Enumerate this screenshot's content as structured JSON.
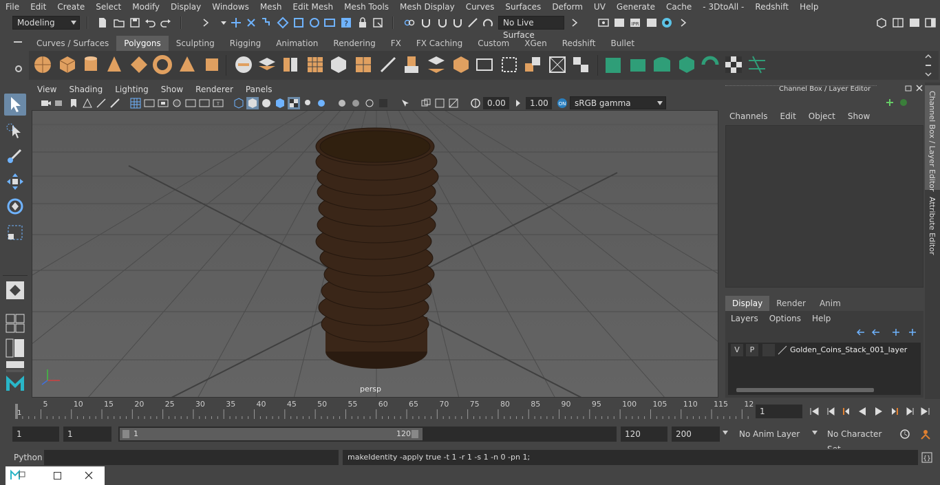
{
  "menubar": {
    "items": [
      "File",
      "Edit",
      "Create",
      "Select",
      "Modify",
      "Display",
      "Windows",
      "Mesh",
      "Edit Mesh",
      "Mesh Tools",
      "Mesh Display",
      "Curves",
      "Surfaces",
      "Deform",
      "UV",
      "Generate",
      "Cache",
      "- 3DtoAll -",
      "Redshift",
      "Help"
    ]
  },
  "statusline": {
    "mode": "Modeling",
    "live_surface": "No Live Surface"
  },
  "shelf": {
    "tabs": [
      "Curves / Surfaces",
      "Polygons",
      "Sculpting",
      "Rigging",
      "Animation",
      "Rendering",
      "FX",
      "FX Caching",
      "Custom",
      "XGen",
      "Redshift",
      "Bullet"
    ],
    "active_tab": "Polygons"
  },
  "viewport": {
    "menus": [
      "View",
      "Shading",
      "Lighting",
      "Show",
      "Renderer",
      "Panels"
    ],
    "exposure": "0.00",
    "gamma": "1.00",
    "color_space": "sRGB gamma",
    "camera_label": "persp"
  },
  "channel_box": {
    "title": "Channel Box / Layer Editor",
    "menus": [
      "Channels",
      "Edit",
      "Object",
      "Show"
    ]
  },
  "layer_editor": {
    "tabs": [
      "Display",
      "Render",
      "Anim"
    ],
    "active_tab": "Display",
    "menus": [
      "Layers",
      "Options",
      "Help"
    ],
    "layer": {
      "v": "V",
      "p": "P",
      "name": "Golden_Coins_Stack_001_layer"
    }
  },
  "side_tabs": {
    "channel_box": "Channel Box / Layer Editor",
    "attribute_editor": "Attribute Editor"
  },
  "timeline": {
    "ticks": [
      "5",
      "10",
      "15",
      "20",
      "25",
      "30",
      "35",
      "40",
      "45",
      "50",
      "55",
      "60",
      "65",
      "70",
      "75",
      "80",
      "85",
      "90",
      "95",
      "100",
      "105",
      "110",
      "115",
      "12"
    ],
    "start_label": "1",
    "current_frame": "1"
  },
  "range": {
    "start": "1",
    "playback_start": "1",
    "slider_start": "1",
    "slider_end": "120",
    "playback_end": "120",
    "end": "200",
    "anim_layer": "No Anim Layer",
    "character_set": "No Character Set"
  },
  "cmdline": {
    "language": "Python",
    "output": "makeIdentity -apply true -t 1 -r 1 -s 1 -n 0 -pn 1;"
  },
  "colors": {
    "accent": "#5d5d5d",
    "shelf_orange": "#e0a060",
    "shelf_green": "#2f9e78",
    "coin": "#3a2618"
  }
}
